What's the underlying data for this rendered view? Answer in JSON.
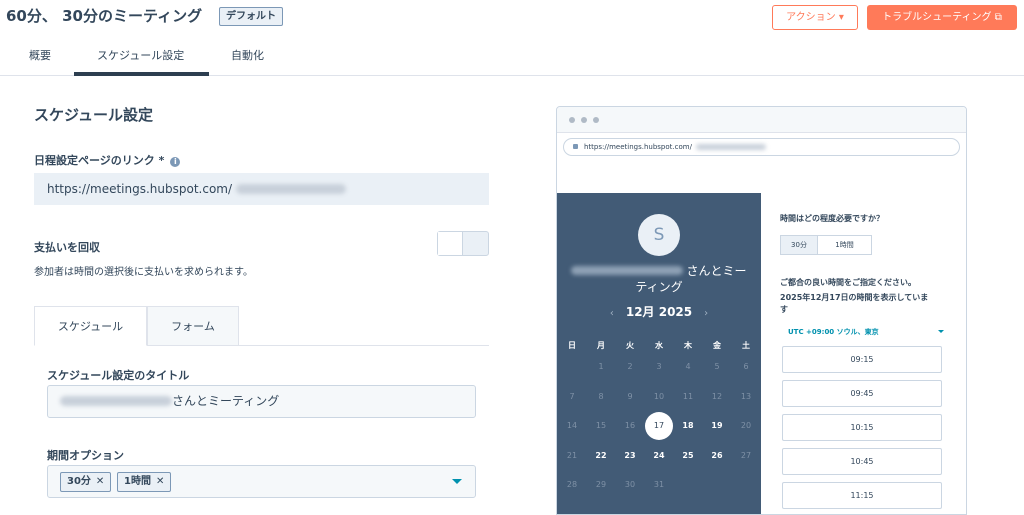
{
  "header": {
    "title": "60分、 30分のミーティング",
    "badge": "デフォルト",
    "action_button": "アクション ▾",
    "troubleshoot_button": "トラブルシューティング ⧉"
  },
  "tabs": [
    "概要",
    "スケジュール設定",
    "自動化"
  ],
  "schedule": {
    "section_title": "スケジュール設定",
    "link_label": "日程設定ページのリンク *",
    "link_value": "https://meetings.hubspot.com/",
    "payment_label": "支払いを回収",
    "payment_desc": "参加者は時間の選択後に支払いを求められます。",
    "subtabs": [
      "スケジュール",
      "フォーム"
    ],
    "title_label": "スケジュール設定のタイトル",
    "title_value": "さんとミーティング",
    "duration_label": "期間オプション",
    "duration_chips": [
      "30分",
      "1時間"
    ]
  },
  "preview": {
    "url": "https://meetings.hubspot.com/",
    "avatar_letter": "S",
    "host_suffix": "さんとミー",
    "host_line2": "ティング",
    "month_label": "12月 2025",
    "weekdays": [
      "日",
      "月",
      "火",
      "水",
      "木",
      "金",
      "土"
    ],
    "calendar_rows": [
      [
        "",
        "1",
        "2",
        "3",
        "4",
        "5",
        "6"
      ],
      [
        "7",
        "8",
        "9",
        "10",
        "11",
        "12",
        "13"
      ],
      [
        "14",
        "15",
        "16",
        "17",
        "18",
        "19",
        "20"
      ],
      [
        "21",
        "22",
        "23",
        "24",
        "25",
        "26",
        "27"
      ],
      [
        "28",
        "29",
        "30",
        "31",
        "",
        "",
        ""
      ]
    ],
    "available_days": [
      "18",
      "19",
      "22",
      "23",
      "24",
      "25",
      "26"
    ],
    "selected_day": "17",
    "question": "時間はどの程度必要ですか？",
    "durations": [
      "30分",
      "1時間"
    ],
    "choose_text": "ご都合の良い時間をご指定ください。",
    "showing_line1": "2025年12月17日の時間を表示していま",
    "showing_line2": "す",
    "timezone": "UTC +09:00 ソウル、東京",
    "slots": [
      "09:15",
      "09:45",
      "10:15",
      "10:45",
      "11:15"
    ]
  },
  "colors": {
    "accent": "#ff7a59",
    "calendar_bg": "#425b76",
    "link": "#0091ae"
  }
}
